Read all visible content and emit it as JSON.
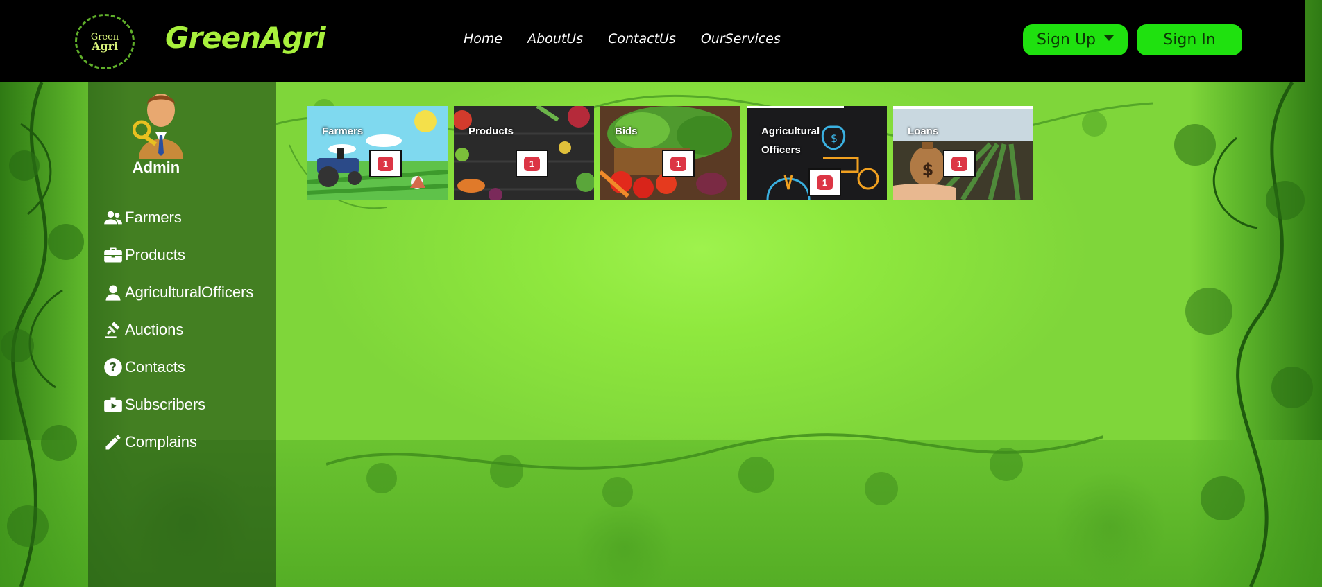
{
  "brand": {
    "logo_line1": "Green",
    "logo_line2": "Agri",
    "name": "GreenAgri"
  },
  "nav": {
    "items": [
      "Home",
      "AboutUs",
      "ContactUs",
      "OurServices"
    ],
    "signup_label": "Sign Up",
    "signin_label": "Sign In"
  },
  "sidebar": {
    "role": "Admin",
    "items": [
      {
        "label": "Farmers",
        "icon": "users-icon"
      },
      {
        "label": "Products",
        "icon": "briefcase-icon"
      },
      {
        "label": "AgriculturalOfficers",
        "icon": "person-icon"
      },
      {
        "label": "Auctions",
        "icon": "gavel-icon"
      },
      {
        "label": "Contacts",
        "icon": "question-icon"
      },
      {
        "label": "Subscribers",
        "icon": "play-briefcase-icon"
      },
      {
        "label": "Complains",
        "icon": "pencil-icon"
      }
    ]
  },
  "cards": [
    {
      "title": "Farmers",
      "count": "1"
    },
    {
      "title": "Products",
      "count": "1"
    },
    {
      "title": "Bids",
      "count": "1"
    },
    {
      "title": "Agricultural Officers",
      "count": "1"
    },
    {
      "title": "Loans",
      "count": "1"
    }
  ],
  "colors": {
    "header_bg": "#000000",
    "brand_green": "#a8f03c",
    "button_green": "#1fe10f",
    "badge_red": "#dc3545"
  }
}
